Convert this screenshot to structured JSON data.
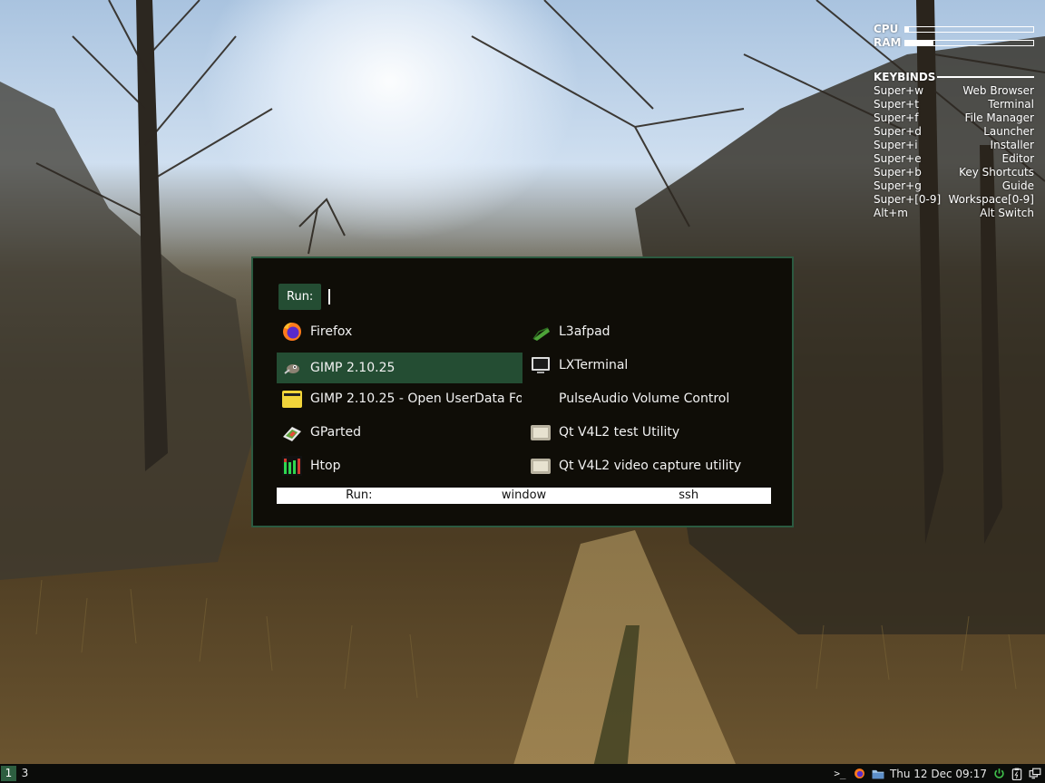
{
  "conky": {
    "cpu_label": "CPU",
    "ram_label": "RAM",
    "cpu_usage_fraction": 0.03,
    "ram_usage_fraction": 0.22,
    "keybinds_title": "KEYBINDS",
    "keybinds": [
      {
        "key": "Super+w",
        "action": "Web Browser"
      },
      {
        "key": "Super+t",
        "action": "Terminal"
      },
      {
        "key": "Super+f",
        "action": "File Manager"
      },
      {
        "key": "Super+d",
        "action": "Launcher"
      },
      {
        "key": "Super+i",
        "action": "Installer"
      },
      {
        "key": "Super+e",
        "action": "Editor"
      },
      {
        "key": "Super+b",
        "action": "Key Shortcuts"
      },
      {
        "key": "Super+g",
        "action": "Guide"
      },
      {
        "key": "Super+[0-9]",
        "action": "Workspace[0-9]"
      },
      {
        "key": "Alt+m",
        "action": "Alt Switch"
      }
    ]
  },
  "launcher": {
    "prompt_label": "Run:",
    "input_value": "",
    "items": [
      {
        "label": "Firefox",
        "icon": "firefox-icon"
      },
      {
        "label": "GIMP 2.10.25",
        "icon": "gimp-icon",
        "selected": true
      },
      {
        "label": "GIMP 2.10.25 - Open UserData Fo...",
        "icon": "folder-icon"
      },
      {
        "label": "GParted",
        "icon": "gparted-icon"
      },
      {
        "label": "Htop",
        "icon": "htop-icon"
      },
      {
        "label": "L3afpad",
        "icon": "l3afpad-icon"
      },
      {
        "label": "LXTerminal",
        "icon": "terminal-icon"
      },
      {
        "label": "PulseAudio Volume Control",
        "icon": ""
      },
      {
        "label": "Qt V4L2 test Utility",
        "icon": "qv4l2-icon"
      },
      {
        "label": "Qt V4L2 video capture utility",
        "icon": "qv4l2-icon"
      }
    ],
    "modes": [
      "Run:",
      "window",
      "ssh"
    ]
  },
  "taskbar": {
    "workspaces": [
      "1",
      "3"
    ],
    "active_workspace": "1",
    "terminal_glyph": ">_",
    "clock": "Thu 12 Dec 09:17"
  },
  "colors": {
    "accent": "#244d33",
    "launcher_bg": "#0f0d07",
    "launcher_border": "#2b5a40",
    "taskbar_bg": "#0b0c0a"
  }
}
